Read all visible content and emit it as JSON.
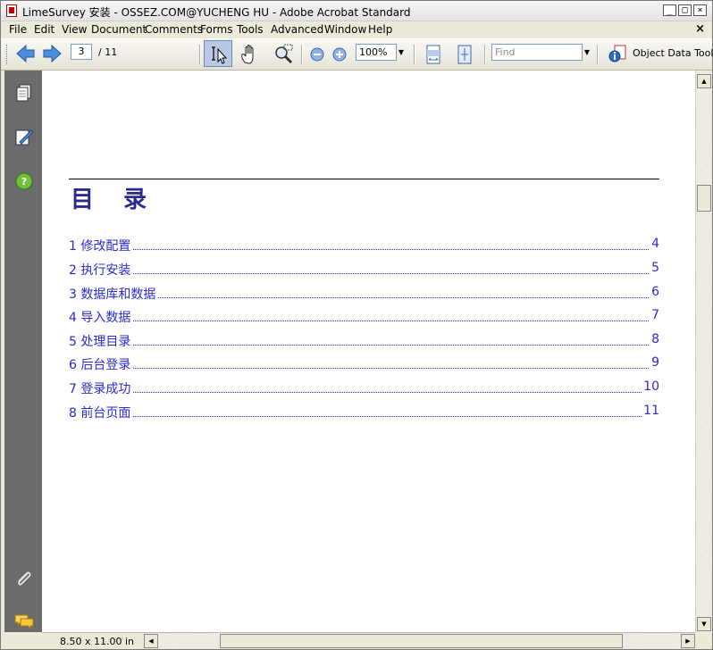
{
  "window": {
    "title": "LimeSurvey 安装 - OSSEZ.COM@YUCHENG HU - Adobe Acrobat Standard",
    "minimize": "_",
    "maximize": "□",
    "close": "×"
  },
  "menu": {
    "items": [
      "File",
      "Edit",
      "View",
      "Document",
      "Comments",
      "Forms",
      "Tools",
      "Advanced",
      "Window",
      "Help"
    ],
    "doc_close": "×"
  },
  "toolbar": {
    "current_page": "3",
    "total_pages": "/ 11",
    "zoom": "100%",
    "find_placeholder": "Find",
    "object_data_tool": "Object Data Tool"
  },
  "document": {
    "toc_title": "目 录",
    "toc": [
      {
        "label": "1 修改配置",
        "page": "4"
      },
      {
        "label": "2 执行安装",
        "page": "5"
      },
      {
        "label": "3 数据库和数据",
        "page": "6"
      },
      {
        "label": "4 导入数据",
        "page": "7"
      },
      {
        "label": "5 处理目录",
        "page": "8"
      },
      {
        "label": "6 后台登录",
        "page": "9"
      },
      {
        "label": "7 登录成功",
        "page": "10"
      },
      {
        "label": "8 前台页面",
        "page": "11"
      }
    ]
  },
  "status": {
    "page_size": "8.50 x 11.00 in"
  },
  "colors": {
    "toc_link": "#2a2ad0",
    "toc_title": "#2b2b8f",
    "nav_pane": "#6b6b6b",
    "active_tool": "#b9c9e3"
  },
  "icons": [
    "pdf-app-icon",
    "previous-page-icon",
    "next-page-icon",
    "select-text-tool-icon",
    "hand-tool-icon",
    "zoom-tool-icon",
    "zoom-out-icon",
    "zoom-in-icon",
    "fit-width-icon",
    "fit-page-icon",
    "object-data-tool-icon",
    "pages-panel-icon",
    "signatures-panel-icon",
    "help-icon",
    "attachments-icon",
    "comments-icon"
  ]
}
